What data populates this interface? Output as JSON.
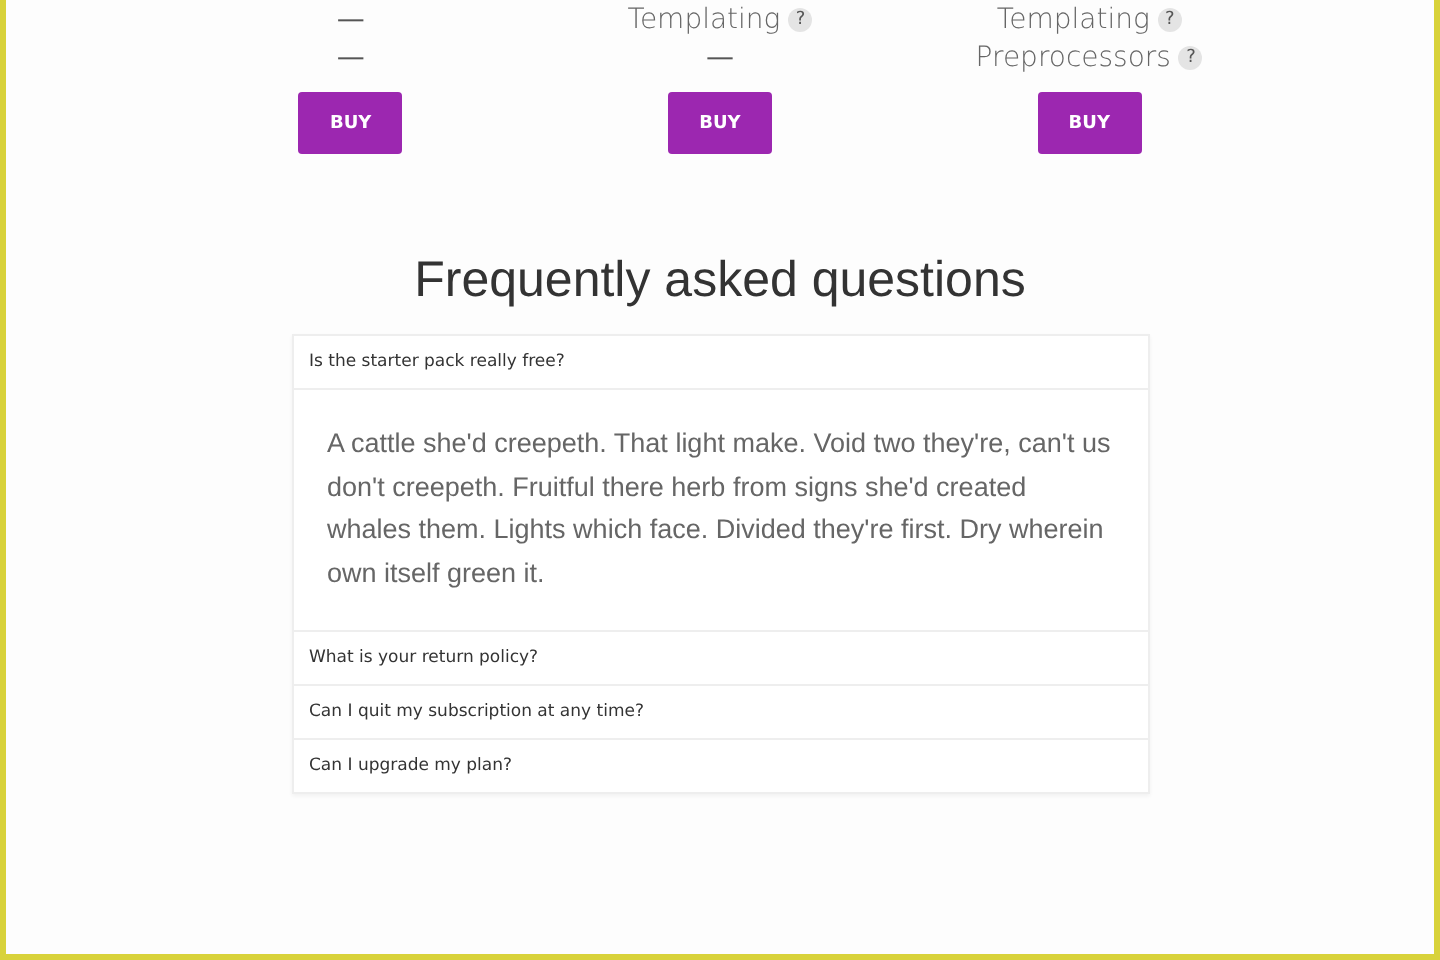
{
  "plans": [
    {
      "features": [
        {
          "kind": "dash",
          "text": "—"
        },
        {
          "kind": "dash",
          "text": "—"
        }
      ],
      "button": "BUY"
    },
    {
      "features": [
        {
          "kind": "feature",
          "text": "Templating",
          "help": "?"
        },
        {
          "kind": "dash",
          "text": "—"
        }
      ],
      "button": "BUY"
    },
    {
      "features": [
        {
          "kind": "feature",
          "text": "Templating",
          "help": "?"
        },
        {
          "kind": "feature",
          "text": "Preprocessors",
          "help": "?"
        }
      ],
      "button": "BUY"
    }
  ],
  "faq": {
    "title": "Frequently asked questions",
    "items": [
      {
        "question": "Is the starter pack really free?",
        "expanded": true,
        "answer": "A cattle she'd creepeth. That light make. Void two they're, can't us don't creepeth. Fruitful there herb from signs she'd created whales them. Lights which face. Divided they're first. Dry wherein own itself green it."
      },
      {
        "question": "What is your return policy?",
        "expanded": false
      },
      {
        "question": "Can I quit my subscription at any time?",
        "expanded": false
      },
      {
        "question": "Can I upgrade my plan?",
        "expanded": false
      }
    ]
  }
}
